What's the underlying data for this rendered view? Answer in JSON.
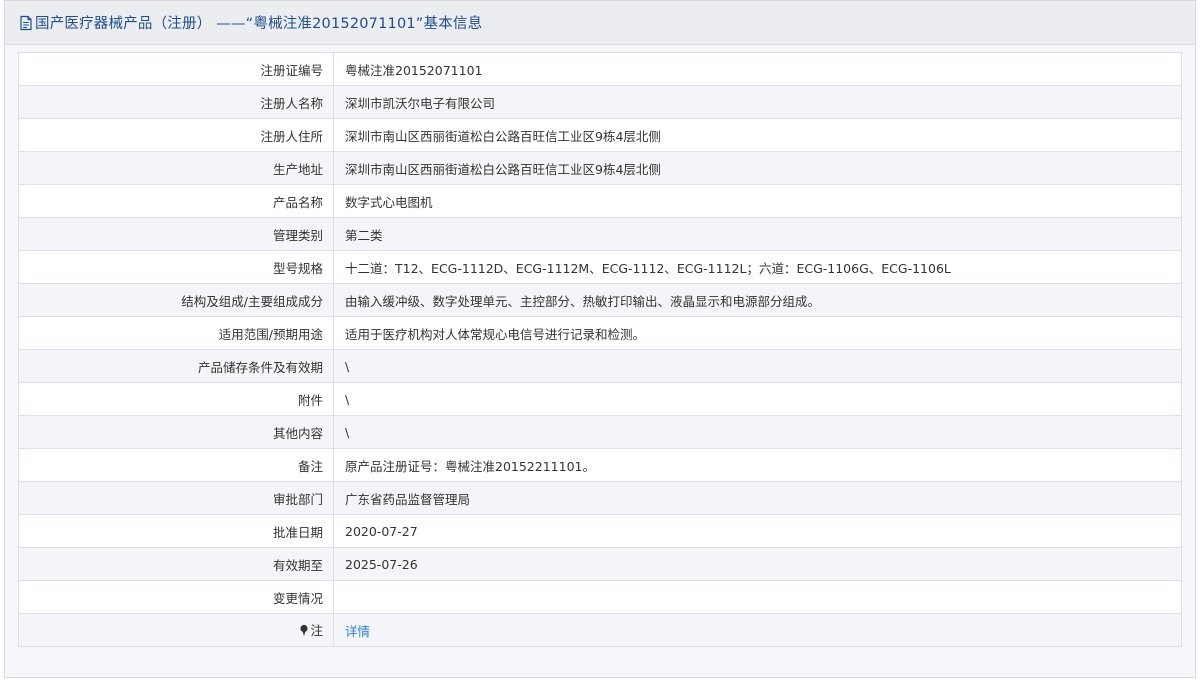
{
  "header": {
    "icon": "document-icon",
    "title": "国产医疗器械产品（注册）  ——“粤械注准20152071101”基本信息"
  },
  "rows": [
    {
      "label": "注册证编号",
      "value": "粤械注准20152071101"
    },
    {
      "label": "注册人名称",
      "value": "深圳市凯沃尔电子有限公司"
    },
    {
      "label": "注册人住所",
      "value": "深圳市南山区西丽街道松白公路百旺信工业区9栋4层北侧"
    },
    {
      "label": "生产地址",
      "value": "深圳市南山区西丽街道松白公路百旺信工业区9栋4层北侧"
    },
    {
      "label": "产品名称",
      "value": "数字式心电图机"
    },
    {
      "label": "管理类别",
      "value": "第二类"
    },
    {
      "label": "型号规格",
      "value": "十二道：T12、ECG-1112D、ECG-1112M、ECG-1112、ECG-1112L；六道：ECG-1106G、ECG-1106L"
    },
    {
      "label": "结构及组成/主要组成成分",
      "value": "由输入缓冲级、数字处理单元、主控部分、热敏打印输出、液晶显示和电源部分组成。"
    },
    {
      "label": "适用范围/预期用途",
      "value": "适用于医疗机构对人体常规心电信号进行记录和检测。"
    },
    {
      "label": "产品储存条件及有效期",
      "value": "\\"
    },
    {
      "label": "附件",
      "value": "\\"
    },
    {
      "label": "其他内容",
      "value": "\\"
    },
    {
      "label": "备注",
      "value": "原产品注册证号：粤械注准20152211101。"
    },
    {
      "label": "审批部门",
      "value": "广东省药品监督管理局"
    },
    {
      "label": "批准日期",
      "value": "2020-07-27"
    },
    {
      "label": "有效期至",
      "value": "2025-07-26"
    },
    {
      "label": "变更情况",
      "value": ""
    }
  ],
  "note_row": {
    "icon": "pin-icon",
    "label": "注",
    "link_text": "详情"
  },
  "colors": {
    "title": "#1f4e8a",
    "link": "#2f7ec7",
    "border": "#dcdfe6",
    "header_bg": "#ecedf0",
    "row_alt_bg": "#f4f5f8"
  }
}
